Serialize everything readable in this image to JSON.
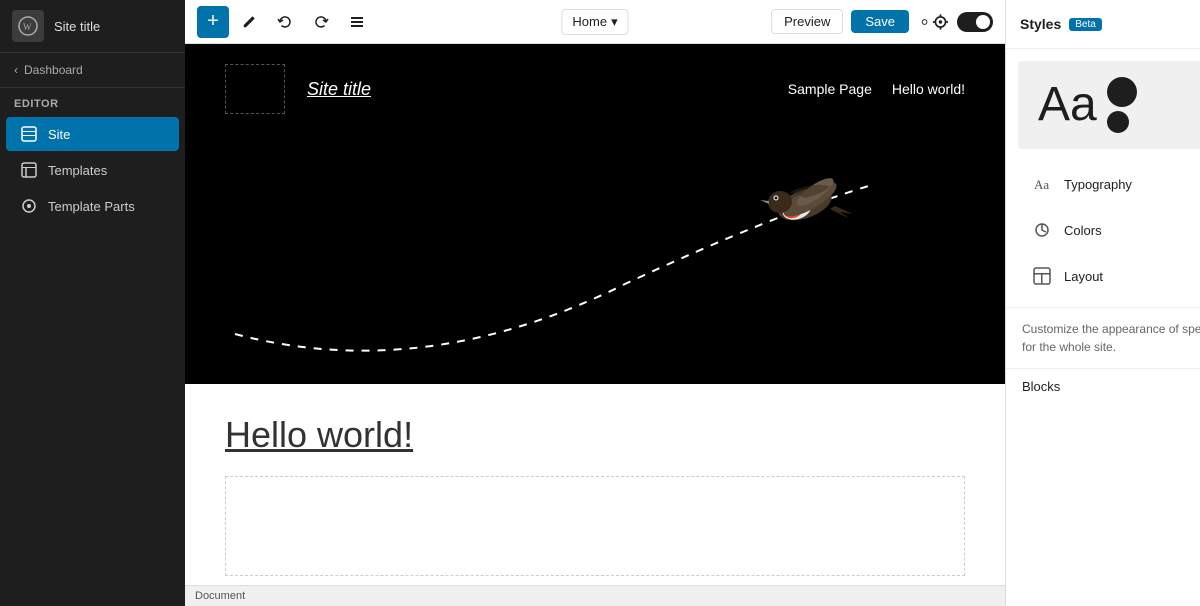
{
  "sidebar": {
    "site_title": "Site title",
    "dashboard_link": "Dashboard",
    "editor_label": "Editor",
    "nav_items": [
      {
        "id": "site",
        "label": "Site",
        "icon": "site-icon",
        "active": true
      },
      {
        "id": "templates",
        "label": "Templates",
        "icon": "templates-icon",
        "active": false
      },
      {
        "id": "template-parts",
        "label": "Template Parts",
        "icon": "template-parts-icon",
        "active": false
      }
    ]
  },
  "toolbar": {
    "add_label": "+",
    "home_label": "Home",
    "home_dropdown_icon": "▾",
    "preview_label": "Preview",
    "save_label": "Save"
  },
  "canvas": {
    "site_title": "Site title",
    "nav_items": [
      "Sample Page",
      "Hello world!"
    ],
    "post_title": "Hello world!",
    "description_text": "Customize the appearance of specific blocks for the whole site."
  },
  "right_panel": {
    "title": "Styles",
    "beta_label": "Beta",
    "preview_text": "Aa",
    "options": [
      {
        "id": "typography",
        "label": "Typography",
        "icon": "typography-icon"
      },
      {
        "id": "colors",
        "label": "Colors",
        "icon": "colors-icon"
      },
      {
        "id": "layout",
        "label": "Layout",
        "icon": "layout-icon"
      }
    ],
    "customize_text": "Customize the appearance of specific blocks for the whole site.",
    "blocks_label": "Blocks"
  },
  "footer": {
    "document_label": "Document"
  }
}
